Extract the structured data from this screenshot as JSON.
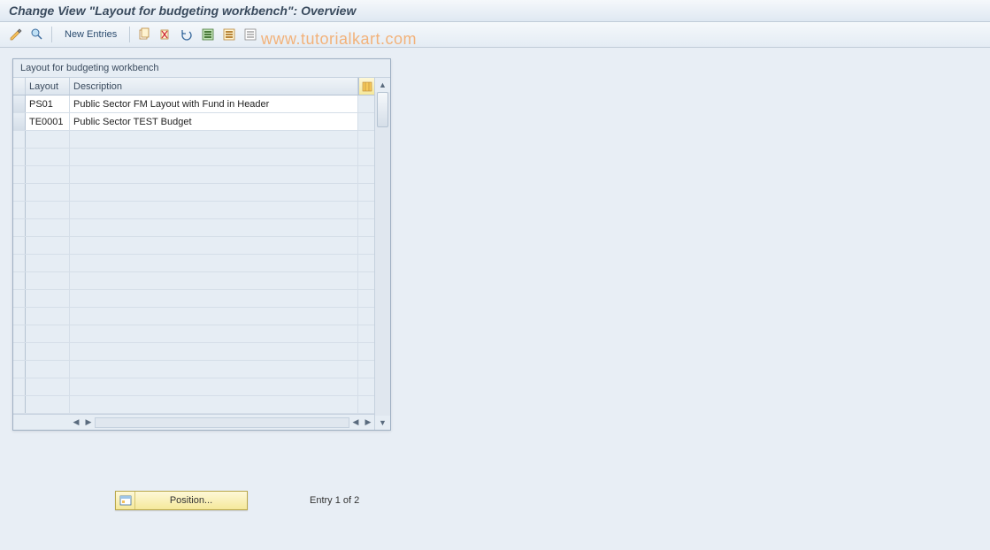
{
  "title": "Change View \"Layout for budgeting workbench\": Overview",
  "toolbar": {
    "new_entries_label": "New Entries"
  },
  "watermark": "www.tutorialkart.com",
  "panel": {
    "title": "Layout for budgeting workbench",
    "columns": {
      "layout": "Layout",
      "description": "Description"
    },
    "rows": [
      {
        "layout": "PS01",
        "description": "Public Sector FM Layout with Fund in Header"
      },
      {
        "layout": "TE0001",
        "description": "Public Sector TEST Budget"
      }
    ],
    "empty_row_count": 16
  },
  "footer": {
    "position_label": "Position...",
    "entry_text": "Entry 1 of 2"
  }
}
